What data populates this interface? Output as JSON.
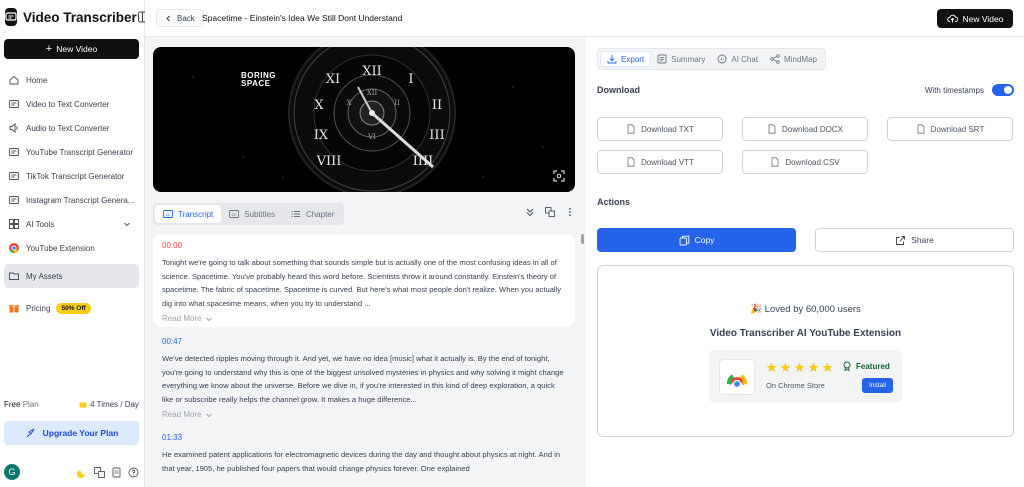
{
  "app": {
    "name": "Video Transcriber"
  },
  "sidebar": {
    "new_video_label": "New Video",
    "items": [
      {
        "label": "Home",
        "icon": "home-icon"
      },
      {
        "label": "Video to Text Converter",
        "icon": "video-icon"
      },
      {
        "label": "Audio to Text Converter",
        "icon": "audio-icon"
      },
      {
        "label": "YouTube Transcript Generator",
        "icon": "youtube-icon"
      },
      {
        "label": "TikTok Transcript Generator",
        "icon": "tiktok-icon"
      },
      {
        "label": "Instagram Transcript Genera...",
        "icon": "instagram-icon"
      },
      {
        "label": "AI Tools",
        "icon": "ai-tools-icon"
      },
      {
        "label": "YouTube Extension",
        "icon": "chrome-icon"
      },
      {
        "label": "My Assets",
        "icon": "folder-icon"
      },
      {
        "label": "Pricing",
        "icon": "gift-icon"
      }
    ],
    "pricing_badge": "50% Off",
    "plan": {
      "name": "Free",
      "suffix": "Plan",
      "uses": "4 Times / Day"
    },
    "upgrade_label": "Upgrade Your Plan",
    "avatar_initial": "G"
  },
  "topbar": {
    "back_label": "Back",
    "title": "Spacetime - Einstein's Idea We Still Dont Understand",
    "new_video_label": "New Video"
  },
  "video": {
    "overlay_text_1": "BORING",
    "overlay_text_2": "SPACE"
  },
  "transcript_tabs": [
    {
      "label": "Transcript",
      "active": true
    },
    {
      "label": "Subtitles",
      "active": false
    },
    {
      "label": "Chapter",
      "active": false
    }
  ],
  "segments": [
    {
      "time": "00:00",
      "text": "Tonight we're going to talk about something that sounds simple but is actually one of the most confusing ideas in all of science. Spacetime. You've probably heard this word before. Scientists throw it around constantly. Einstein's theory of spacetime. The fabric of spacetime. Spacetime is curved. But here's what most people don't realize. When you actually dig into what spacetime means, when you try to understand ...",
      "read_more": "Read More"
    },
    {
      "time": "00:47",
      "text": "We've detected ripples moving through it. And yet, we have no idea [music] what it actually is. By the end of tonight, you're going to understand why this is one of the biggest unsolved mysteries in physics and why solving it might change everything we know about the universe. Before we dive in, if you're interested in this kind of deep exploration, a quick like or subscribe really helps the channel grow. It makes a huge difference...",
      "read_more": "Read More"
    },
    {
      "time": "01:33",
      "text": "He examined patent applications for electromagnetic devices during the day and thought about physics at night. And in that year, 1905, he published four papers that would change physics forever. One explained",
      "read_more": ""
    }
  ],
  "right_tabs": [
    {
      "label": "Export",
      "active": true
    },
    {
      "label": "Summary",
      "active": false
    },
    {
      "label": "AI Chat",
      "active": false
    },
    {
      "label": "MindMap",
      "active": false
    }
  ],
  "download": {
    "heading": "Download",
    "timestamps_label": "With timestamps",
    "timestamps_on": true,
    "buttons": [
      "Download TXT",
      "Download DOCX",
      "Download SRT",
      "Download VTT",
      "Download CSV"
    ]
  },
  "actions": {
    "heading": "Actions",
    "copy_label": "Copy",
    "share_label": "Share"
  },
  "promo": {
    "loved": "Loved by 60,000 users",
    "emoji": "🎉",
    "title": "Video Transcriber AI YouTube Extension",
    "featured": "Featured",
    "store": "On Chrome Store",
    "install": "Install",
    "rating": 5
  },
  "colors": {
    "accent": "#2563eb",
    "dark": "#111111",
    "badge": "#facc15"
  }
}
